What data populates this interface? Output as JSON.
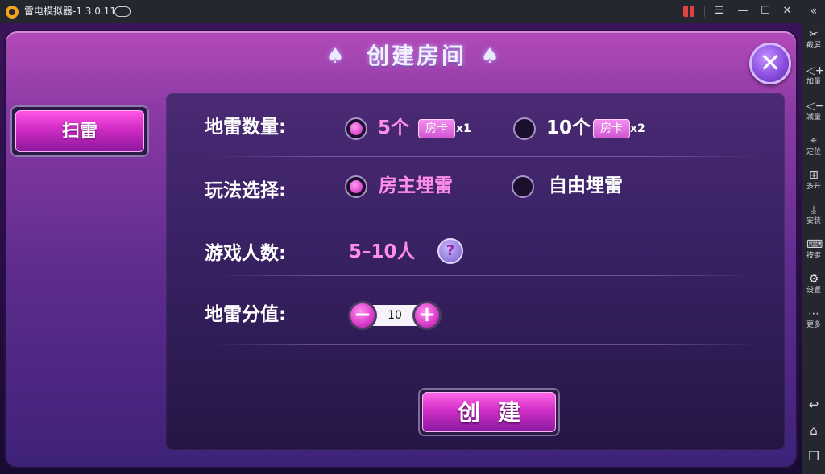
{
  "titlebar": {
    "title": "雷电模拟器-1 3.0.11",
    "icons": [
      "app-logo-icon",
      "gamepad-icon",
      "gift-icon",
      "menu-icon",
      "minimize-icon",
      "maximize-icon",
      "close-icon",
      "collapse-sidebar-icon"
    ]
  },
  "sidebar": {
    "items": [
      {
        "label": "截屏",
        "icon": "scissors-icon"
      },
      {
        "label": "加量",
        "icon": "volume-up-icon"
      },
      {
        "label": "减量",
        "icon": "volume-down-icon"
      },
      {
        "label": "定位",
        "icon": "location-icon"
      },
      {
        "label": "多开",
        "icon": "multi-instance-icon"
      },
      {
        "label": "安装",
        "icon": "install-apk-icon"
      },
      {
        "label": "按键",
        "icon": "keyboard-icon"
      },
      {
        "label": "设置",
        "icon": "gear-icon"
      },
      {
        "label": "更多",
        "icon": "more-icon"
      }
    ],
    "nav": [
      "back-icon",
      "home-icon",
      "recent-apps-icon"
    ]
  },
  "dialog": {
    "title": "创建房间",
    "close_label": "✕",
    "left_tab": "扫雷",
    "rows": {
      "mine_count": {
        "label": "地雷数量:",
        "options": [
          {
            "text": "5个",
            "badge": "房卡",
            "multiplier": "x1",
            "selected": true
          },
          {
            "text": "10个",
            "badge": "房卡",
            "multiplier": "x2",
            "selected": false
          }
        ]
      },
      "play_mode": {
        "label": "玩法选择:",
        "options": [
          {
            "text": "房主埋雷",
            "selected": true
          },
          {
            "text": "自由埋雷",
            "selected": false
          }
        ]
      },
      "players": {
        "label": "游戏人数:",
        "value": "5–10人",
        "help": "?"
      },
      "mine_value": {
        "label": "地雷分值:",
        "value": "10",
        "minus": "−",
        "plus": "+"
      }
    },
    "create_label": "创建"
  },
  "colors": {
    "accent_pink": "#ff8ee9",
    "button_pink": "#d12fc7",
    "panel": "#3a2264",
    "dialog_top": "#b34ab9",
    "titlebar_bg": "#25272e"
  }
}
